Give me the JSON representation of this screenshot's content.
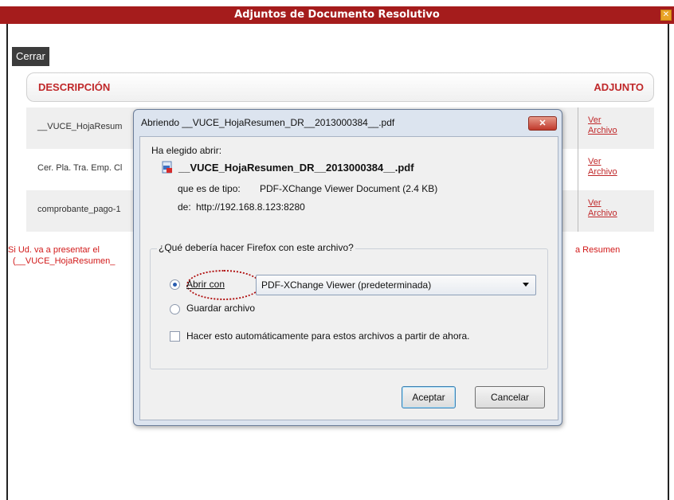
{
  "window": {
    "title": "Adjuntos de Documento Resolutivo"
  },
  "toolbar": {
    "close_label": "Cerrar"
  },
  "table": {
    "headers": [
      "DESCRIPCIÓN",
      "ADJUNTO"
    ],
    "rows": [
      {
        "description": "__VUCE_HojaResum",
        "link_line1": "Ver",
        "link_line2": "Archivo"
      },
      {
        "description": "Cer. Pla. Tra. Emp. Cl",
        "link_line1": "Ver",
        "link_line2": "Archivo"
      },
      {
        "description": "comprobante_pago-1",
        "link_line1": "Ver",
        "link_line2": "Archivo"
      }
    ]
  },
  "note": {
    "line1_start": "Si Ud. va a presentar el",
    "line1_end": "a Resumen",
    "line2": "(__VUCE_HojaResumen_"
  },
  "dialog": {
    "title": "Abriendo __VUCE_HojaResumen_DR__2013000384__.pdf",
    "chose_label": "Ha elegido abrir:",
    "filename": "__VUCE_HojaResumen_DR__2013000384__.pdf",
    "type_label": "que es de tipo:",
    "type_value": "PDF-XChange Viewer Document (2.4 KB)",
    "from_label": "de:",
    "from_value": "http://192.168.8.123:8280",
    "question": "¿Qué debería hacer Firefox con este archivo?",
    "open_with_label": "Abrir con",
    "open_with_selected": "PDF-XChange Viewer (predeterminada)",
    "save_label": "Guardar archivo",
    "auto_label": "Hacer esto automáticamente para estos archivos a partir de ahora.",
    "ok_label": "Aceptar",
    "cancel_label": "Cancelar"
  }
}
